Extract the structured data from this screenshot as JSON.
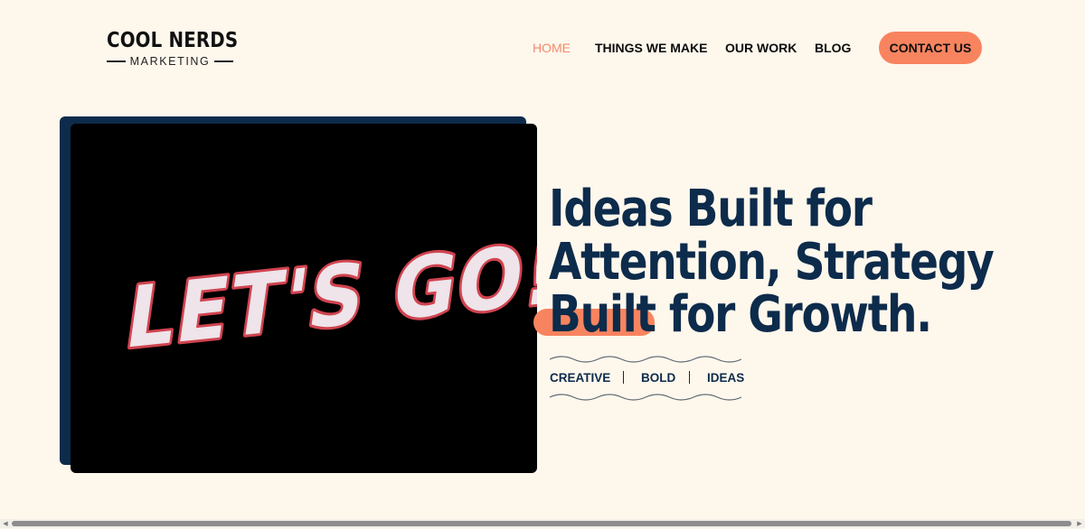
{
  "brand": {
    "name": "COOL NERDS",
    "tagline": "MARKETING"
  },
  "nav": {
    "items": [
      {
        "label": "HOME",
        "active": true
      },
      {
        "label": "THINGS WE MAKE",
        "active": false
      },
      {
        "label": "OUR WORK",
        "active": false
      },
      {
        "label": "BLOG",
        "active": false
      }
    ],
    "cta_label": "CONTACT US"
  },
  "hero": {
    "video_text": "LET'S GO!",
    "title_lines": [
      "Ideas Built for",
      "Attention, Strategy",
      "Built for Growth."
    ],
    "tags": [
      "CREATIVE",
      "BOLD",
      "IDEAS"
    ]
  },
  "colors": {
    "background": "#fef7ec",
    "navy": "#0d2b4b",
    "accent": "#f8845f",
    "active_link": "#f48a6b",
    "video_bg": "#000000",
    "video_text_fill": "#eee4ea",
    "video_text_outline": "#d0434f"
  }
}
